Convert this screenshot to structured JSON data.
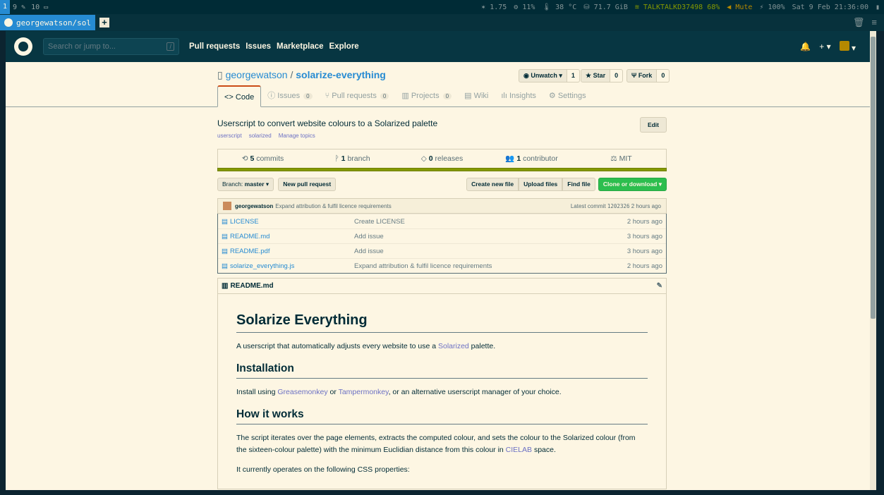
{
  "system": {
    "workspaces": [
      "1",
      "9",
      "10"
    ],
    "load": "1.75",
    "cpu": "11%",
    "temp": "38 °C",
    "disk": "71.7 GiB",
    "network": "TALKTALKD37498 68%",
    "volume": "Mute",
    "battery": "100%",
    "datetime": "Sat 9 Feb 21:36:00"
  },
  "browser": {
    "tab_title": "georgewatson/sol"
  },
  "github": {
    "search_placeholder": "Search or jump to...",
    "search_shortcut": "/",
    "nav": [
      "Pull requests",
      "Issues",
      "Marketplace",
      "Explore"
    ]
  },
  "repo": {
    "owner": "georgewatson",
    "name": "solarize-everything",
    "unwatch_label": "Unwatch ▾",
    "unwatch_count": "1",
    "star_label": "Star",
    "star_count": "0",
    "fork_label": "Fork",
    "fork_count": "0",
    "tabs": [
      {
        "label": "Code",
        "count": ""
      },
      {
        "label": "Issues",
        "count": "0"
      },
      {
        "label": "Pull requests",
        "count": "0"
      },
      {
        "label": "Projects",
        "count": "0"
      },
      {
        "label": "Wiki",
        "count": ""
      },
      {
        "label": "Insights",
        "count": ""
      },
      {
        "label": "Settings",
        "count": ""
      }
    ],
    "description": "Userscript to convert website colours to a Solarized palette",
    "edit_label": "Edit",
    "topics": [
      "userscript",
      "solarized",
      "Manage topics"
    ],
    "stats": {
      "commits": "5",
      "commits_label": "commits",
      "branches": "1",
      "branches_label": "branch",
      "releases": "0",
      "releases_label": "releases",
      "contributors": "1",
      "contributors_label": "contributor",
      "license": "MIT"
    },
    "branch_label": "Branch:",
    "branch": "master",
    "new_pr_label": "New pull request",
    "create_file_label": "Create new file",
    "upload_label": "Upload files",
    "find_label": "Find file",
    "clone_label": "Clone or download ▾",
    "commit": {
      "author": "georgewatson",
      "message": "Expand attribution & fulfil licence requirements",
      "latest_label": "Latest commit",
      "sha": "1202326",
      "age": "2 hours ago"
    },
    "files": [
      {
        "name": "LICENSE",
        "message": "Create LICENSE",
        "age": "2 hours ago"
      },
      {
        "name": "README.md",
        "message": "Add issue",
        "age": "3 hours ago"
      },
      {
        "name": "README.pdf",
        "message": "Add issue",
        "age": "3 hours ago"
      },
      {
        "name": "solarize_everything.js",
        "message": "Expand attribution & fulfil licence requirements",
        "age": "2 hours ago"
      }
    ]
  },
  "readme": {
    "file": "README.md",
    "h1": "Solarize Everything",
    "p1_before": "A userscript that automatically adjusts every website to use a ",
    "p1_link": "Solarized",
    "p1_after": " palette.",
    "h2_install": "Installation",
    "p2_before": "Install using ",
    "p2_link1": "Greasemonkey",
    "p2_mid": " or ",
    "p2_link2": "Tampermonkey",
    "p2_after": ", or an alternative userscript manager of your choice.",
    "h2_how": "How it works",
    "p3_before": "The script iterates over the page elements, extracts the computed colour, and sets the colour to the Solarized colour (from the sixteen-colour palette) with the minimum Euclidian distance from this colour in ",
    "p3_link": "CIELAB",
    "p3_after": " space.",
    "p4": "It currently operates on the following CSS properties:"
  }
}
